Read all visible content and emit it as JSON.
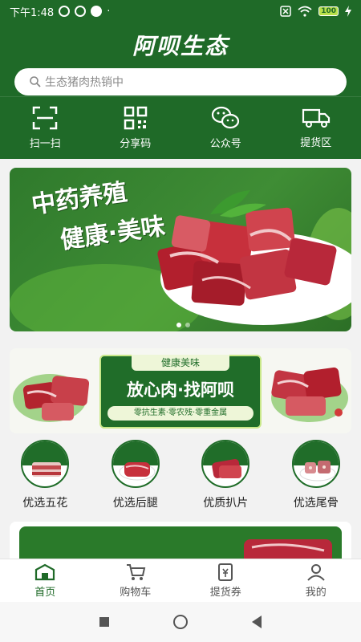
{
  "status_bar": {
    "time": "下午1:48",
    "battery": "100"
  },
  "header": {
    "logo": "阿呗生态"
  },
  "search": {
    "placeholder": "生态猪肉热销中"
  },
  "quick_nav": [
    {
      "label": "扫一扫",
      "icon": "scan-icon"
    },
    {
      "label": "分享码",
      "icon": "qr-code-icon"
    },
    {
      "label": "公众号",
      "icon": "wechat-icon"
    },
    {
      "label": "提货区",
      "icon": "truck-icon"
    }
  ],
  "banner": {
    "line1": "中药养殖",
    "line2": "健康·美味"
  },
  "promo": {
    "tag": "健康美味",
    "main": "放心肉·找阿呗",
    "sub": "零抗生素·零农残·零重金属"
  },
  "categories": [
    {
      "label": "优选五花"
    },
    {
      "label": "优选后腿"
    },
    {
      "label": "优质扒片"
    },
    {
      "label": "优选尾骨"
    }
  ],
  "tab_bar": [
    {
      "label": "首页",
      "icon": "home-icon",
      "active": true
    },
    {
      "label": "购物车",
      "icon": "cart-icon",
      "active": false
    },
    {
      "label": "提货券",
      "icon": "coupon-icon",
      "active": false
    },
    {
      "label": "我的",
      "icon": "user-icon",
      "active": false
    }
  ],
  "colors": {
    "brand": "#1f6a28",
    "accent": "#c9e88a"
  }
}
